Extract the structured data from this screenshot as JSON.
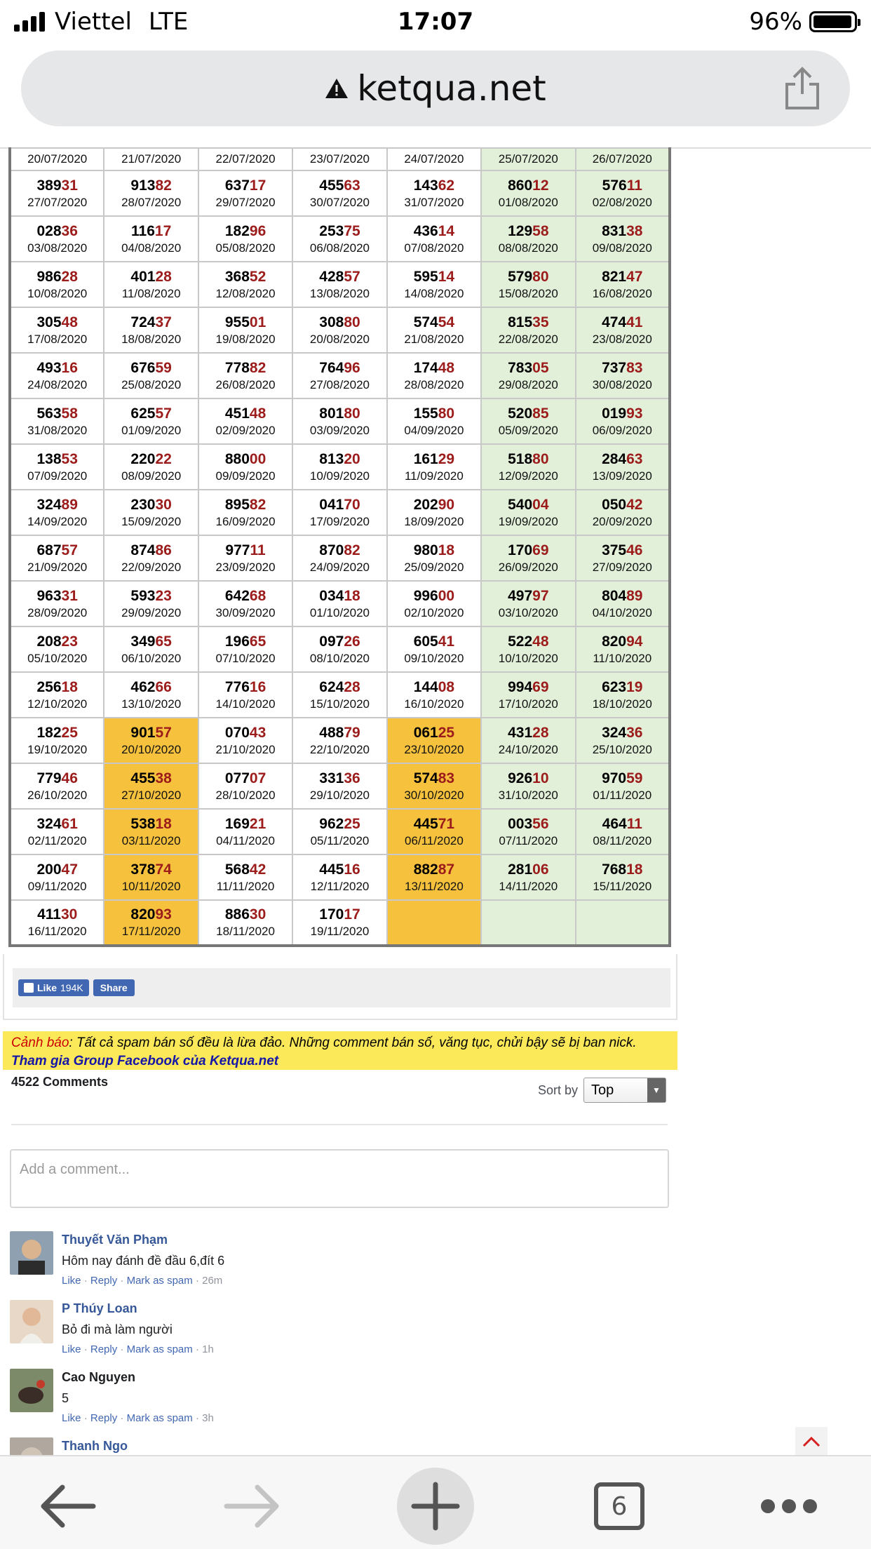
{
  "status_bar": {
    "carrier": "Viettel",
    "network": "LTE",
    "time": "17:07",
    "battery": "96%",
    "battery_level": 0.96
  },
  "browser": {
    "url": "ketqua.net",
    "open_tabs": "6"
  },
  "results": [
    [
      {
        "d": "20/07/2020"
      },
      {
        "d": "21/07/2020"
      },
      {
        "d": "22/07/2020"
      },
      {
        "d": "23/07/2020"
      },
      {
        "d": "24/07/2020"
      },
      {
        "d": "25/07/2020"
      },
      {
        "d": "26/07/2020"
      }
    ],
    [
      {
        "n": "38931",
        "d": "27/07/2020"
      },
      {
        "n": "91382",
        "d": "28/07/2020"
      },
      {
        "n": "63717",
        "d": "29/07/2020"
      },
      {
        "n": "45563",
        "d": "30/07/2020"
      },
      {
        "n": "14362",
        "d": "31/07/2020"
      },
      {
        "n": "86012",
        "d": "01/08/2020"
      },
      {
        "n": "57611",
        "d": "02/08/2020"
      }
    ],
    [
      {
        "n": "02836",
        "d": "03/08/2020"
      },
      {
        "n": "11617",
        "d": "04/08/2020"
      },
      {
        "n": "18296",
        "d": "05/08/2020"
      },
      {
        "n": "25375",
        "d": "06/08/2020"
      },
      {
        "n": "43614",
        "d": "07/08/2020"
      },
      {
        "n": "12958",
        "d": "08/08/2020"
      },
      {
        "n": "83138",
        "d": "09/08/2020"
      }
    ],
    [
      {
        "n": "98628",
        "d": "10/08/2020"
      },
      {
        "n": "40128",
        "d": "11/08/2020"
      },
      {
        "n": "36852",
        "d": "12/08/2020"
      },
      {
        "n": "42857",
        "d": "13/08/2020"
      },
      {
        "n": "59514",
        "d": "14/08/2020"
      },
      {
        "n": "57980",
        "d": "15/08/2020"
      },
      {
        "n": "82147",
        "d": "16/08/2020"
      }
    ],
    [
      {
        "n": "30548",
        "d": "17/08/2020"
      },
      {
        "n": "72437",
        "d": "18/08/2020"
      },
      {
        "n": "95501",
        "d": "19/08/2020"
      },
      {
        "n": "30880",
        "d": "20/08/2020"
      },
      {
        "n": "57454",
        "d": "21/08/2020"
      },
      {
        "n": "81535",
        "d": "22/08/2020"
      },
      {
        "n": "47441",
        "d": "23/08/2020"
      }
    ],
    [
      {
        "n": "49316",
        "d": "24/08/2020"
      },
      {
        "n": "67659",
        "d": "25/08/2020"
      },
      {
        "n": "77882",
        "d": "26/08/2020"
      },
      {
        "n": "76496",
        "d": "27/08/2020"
      },
      {
        "n": "17448",
        "d": "28/08/2020"
      },
      {
        "n": "78305",
        "d": "29/08/2020"
      },
      {
        "n": "73783",
        "d": "30/08/2020"
      }
    ],
    [
      {
        "n": "56358",
        "d": "31/08/2020"
      },
      {
        "n": "62557",
        "d": "01/09/2020"
      },
      {
        "n": "45148",
        "d": "02/09/2020"
      },
      {
        "n": "80180",
        "d": "03/09/2020"
      },
      {
        "n": "15580",
        "d": "04/09/2020"
      },
      {
        "n": "52085",
        "d": "05/09/2020"
      },
      {
        "n": "01993",
        "d": "06/09/2020"
      }
    ],
    [
      {
        "n": "13853",
        "d": "07/09/2020"
      },
      {
        "n": "22022",
        "d": "08/09/2020"
      },
      {
        "n": "88000",
        "d": "09/09/2020"
      },
      {
        "n": "81320",
        "d": "10/09/2020"
      },
      {
        "n": "16129",
        "d": "11/09/2020"
      },
      {
        "n": "51880",
        "d": "12/09/2020"
      },
      {
        "n": "28463",
        "d": "13/09/2020"
      }
    ],
    [
      {
        "n": "32489",
        "d": "14/09/2020"
      },
      {
        "n": "23030",
        "d": "15/09/2020"
      },
      {
        "n": "89582",
        "d": "16/09/2020"
      },
      {
        "n": "04170",
        "d": "17/09/2020"
      },
      {
        "n": "20290",
        "d": "18/09/2020"
      },
      {
        "n": "54004",
        "d": "19/09/2020"
      },
      {
        "n": "05042",
        "d": "20/09/2020"
      }
    ],
    [
      {
        "n": "68757",
        "d": "21/09/2020"
      },
      {
        "n": "87486",
        "d": "22/09/2020"
      },
      {
        "n": "97711",
        "d": "23/09/2020"
      },
      {
        "n": "87082",
        "d": "24/09/2020"
      },
      {
        "n": "98018",
        "d": "25/09/2020"
      },
      {
        "n": "17069",
        "d": "26/09/2020"
      },
      {
        "n": "37546",
        "d": "27/09/2020"
      }
    ],
    [
      {
        "n": "96331",
        "d": "28/09/2020"
      },
      {
        "n": "59323",
        "d": "29/09/2020"
      },
      {
        "n": "64268",
        "d": "30/09/2020"
      },
      {
        "n": "03418",
        "d": "01/10/2020"
      },
      {
        "n": "99600",
        "d": "02/10/2020"
      },
      {
        "n": "49797",
        "d": "03/10/2020"
      },
      {
        "n": "80489",
        "d": "04/10/2020"
      }
    ],
    [
      {
        "n": "20823",
        "d": "05/10/2020"
      },
      {
        "n": "34965",
        "d": "06/10/2020"
      },
      {
        "n": "19665",
        "d": "07/10/2020"
      },
      {
        "n": "09726",
        "d": "08/10/2020"
      },
      {
        "n": "60541",
        "d": "09/10/2020"
      },
      {
        "n": "52248",
        "d": "10/10/2020"
      },
      {
        "n": "82094",
        "d": "11/10/2020"
      }
    ],
    [
      {
        "n": "25618",
        "d": "12/10/2020"
      },
      {
        "n": "46266",
        "d": "13/10/2020"
      },
      {
        "n": "77616",
        "d": "14/10/2020"
      },
      {
        "n": "62428",
        "d": "15/10/2020"
      },
      {
        "n": "14408",
        "d": "16/10/2020"
      },
      {
        "n": "99469",
        "d": "17/10/2020"
      },
      {
        "n": "62319",
        "d": "18/10/2020"
      }
    ],
    [
      {
        "n": "18225",
        "d": "19/10/2020"
      },
      {
        "n": "90157",
        "d": "20/10/2020",
        "h": true
      },
      {
        "n": "07043",
        "d": "21/10/2020"
      },
      {
        "n": "48879",
        "d": "22/10/2020"
      },
      {
        "n": "06125",
        "d": "23/10/2020",
        "h": true
      },
      {
        "n": "43128",
        "d": "24/10/2020"
      },
      {
        "n": "32436",
        "d": "25/10/2020"
      }
    ],
    [
      {
        "n": "77946",
        "d": "26/10/2020"
      },
      {
        "n": "45538",
        "d": "27/10/2020",
        "h": true
      },
      {
        "n": "07707",
        "d": "28/10/2020"
      },
      {
        "n": "33136",
        "d": "29/10/2020"
      },
      {
        "n": "57483",
        "d": "30/10/2020",
        "h": true
      },
      {
        "n": "92610",
        "d": "31/10/2020"
      },
      {
        "n": "97059",
        "d": "01/11/2020"
      }
    ],
    [
      {
        "n": "32461",
        "d": "02/11/2020"
      },
      {
        "n": "53818",
        "d": "03/11/2020",
        "h": true
      },
      {
        "n": "16921",
        "d": "04/11/2020"
      },
      {
        "n": "96225",
        "d": "05/11/2020"
      },
      {
        "n": "44571",
        "d": "06/11/2020",
        "h": true
      },
      {
        "n": "00356",
        "d": "07/11/2020"
      },
      {
        "n": "46411",
        "d": "08/11/2020"
      }
    ],
    [
      {
        "n": "20047",
        "d": "09/11/2020"
      },
      {
        "n": "37874",
        "d": "10/11/2020",
        "h": true
      },
      {
        "n": "56842",
        "d": "11/11/2020"
      },
      {
        "n": "44516",
        "d": "12/11/2020"
      },
      {
        "n": "88287",
        "d": "13/11/2020",
        "h": true
      },
      {
        "n": "28106",
        "d": "14/11/2020"
      },
      {
        "n": "76818",
        "d": "15/11/2020"
      }
    ],
    [
      {
        "n": "41130",
        "d": "16/11/2020"
      },
      {
        "n": "82093",
        "d": "17/11/2020",
        "h": true
      },
      {
        "n": "88630",
        "d": "18/11/2020"
      },
      {
        "n": "17017",
        "d": "19/11/2020"
      },
      {
        "h": true
      },
      {},
      {}
    ]
  ],
  "facebook": {
    "like_label": "Like",
    "like_count": "194K",
    "share_label": "Share"
  },
  "warning": {
    "label": "Cảnh báo",
    "text": ": Tất cả spam bán số đều là lừa đảo. Những comment bán số, văng tục, chửi bậy sẽ bị ban nick.",
    "group_link": "Tham gia Group Facebook của Ketqua.net"
  },
  "comments_section": {
    "count": "4522 Comments",
    "sort_label": "Sort by",
    "sort_value": "Top",
    "input_placeholder": "Add a comment...",
    "like": "Like",
    "reply": "Reply",
    "spam": "Mark as spam",
    "items": [
      {
        "author": "Thuyết Văn Phạm",
        "text": "Hôm nay đánh đề đầu 6,đít 6",
        "time": "26m"
      },
      {
        "author": "P Thúy Loan",
        "text": "Bỏ đi mà làm người",
        "time": "1h"
      },
      {
        "author": "Cao Nguyen",
        "text": "5",
        "time": "3h"
      },
      {
        "author": "Thanh Ngo",
        "text": "",
        "time": ""
      }
    ]
  },
  "colors": {
    "highlight": "#f6c23e",
    "weekend": "#e2f0da",
    "number_accent": "#9c1b1b",
    "link": "#365899"
  }
}
